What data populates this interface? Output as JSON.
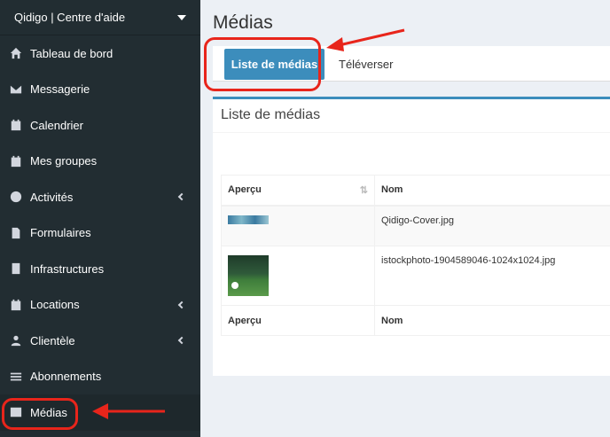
{
  "sidebar": {
    "brand": "Qidigo | Centre d'aide",
    "items": [
      {
        "label": "Tableau de bord",
        "icon": "home-icon",
        "has_chevron": false
      },
      {
        "label": "Messagerie",
        "icon": "envelope-icon",
        "has_chevron": false
      },
      {
        "label": "Calendrier",
        "icon": "calendar-icon",
        "has_chevron": false
      },
      {
        "label": "Mes groupes",
        "icon": "calendar-icon",
        "has_chevron": false
      },
      {
        "label": "Activités",
        "icon": "soccer-ball-icon",
        "has_chevron": true
      },
      {
        "label": "Formulaires",
        "icon": "file-icon",
        "has_chevron": false
      },
      {
        "label": "Infrastructures",
        "icon": "building-icon",
        "has_chevron": false
      },
      {
        "label": "Locations",
        "icon": "calendar-plus-icon",
        "has_chevron": true
      },
      {
        "label": "Clientèle",
        "icon": "users-icon",
        "has_chevron": true
      },
      {
        "label": "Abonnements",
        "icon": "list-icon",
        "has_chevron": false
      },
      {
        "label": "Médias",
        "icon": "film-icon",
        "has_chevron": false
      }
    ]
  },
  "main": {
    "title": "Médias",
    "tabs": [
      {
        "label": "Liste de médias",
        "active": true
      },
      {
        "label": "Téléverser",
        "active": false
      }
    ],
    "box_title": "Liste de médias",
    "table": {
      "headers": [
        "Aperçu",
        "Nom"
      ],
      "rows": [
        {
          "name": "Qidigo-Cover.jpg"
        },
        {
          "name": "istockphoto-1904589046-1024x1024.jpg"
        }
      ],
      "footer": [
        "Aperçu",
        "Nom"
      ]
    }
  },
  "colors": {
    "sidebar_bg": "#222d32",
    "accent": "#3c8dbc",
    "annotation": "#e8251b"
  }
}
